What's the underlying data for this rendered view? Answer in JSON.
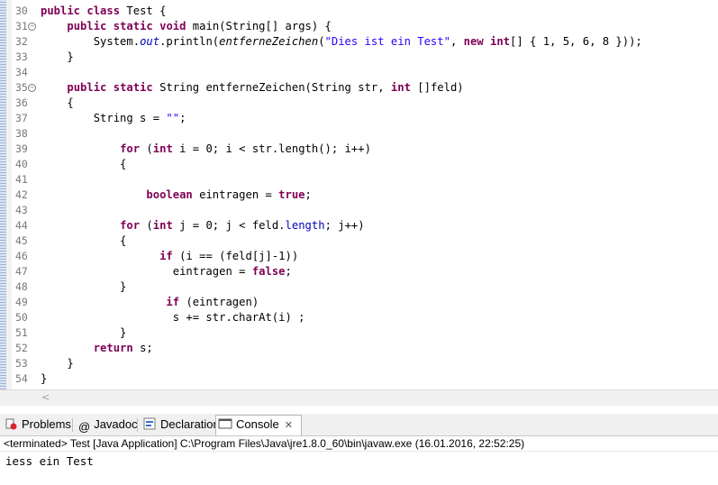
{
  "editor": {
    "lines": [
      {
        "n": "30",
        "fold": false,
        "tokens": [
          [
            "kw",
            "public"
          ],
          [
            "p",
            " "
          ],
          [
            "kw",
            "class"
          ],
          [
            "p",
            " Test {"
          ]
        ]
      },
      {
        "n": "31",
        "fold": true,
        "tokens": [
          [
            "p",
            "    "
          ],
          [
            "kw",
            "public"
          ],
          [
            "p",
            " "
          ],
          [
            "kw",
            "static"
          ],
          [
            "p",
            " "
          ],
          [
            "kw",
            "void"
          ],
          [
            "p",
            " main(String[] args) {"
          ]
        ]
      },
      {
        "n": "32",
        "fold": false,
        "tokens": [
          [
            "p",
            "        System."
          ],
          [
            "fldit",
            "out"
          ],
          [
            "p",
            ".println("
          ],
          [
            "it",
            "entferneZeichen"
          ],
          [
            "p",
            "("
          ],
          [
            "str",
            "\"Dies ist ein Test\""
          ],
          [
            "p",
            ", "
          ],
          [
            "kw",
            "new"
          ],
          [
            "p",
            " "
          ],
          [
            "kw",
            "int"
          ],
          [
            "p",
            "[] { 1, 5, 6, 8 }));"
          ]
        ]
      },
      {
        "n": "33",
        "fold": false,
        "tokens": [
          [
            "p",
            "    }"
          ]
        ]
      },
      {
        "n": "34",
        "fold": false,
        "tokens": []
      },
      {
        "n": "35",
        "fold": true,
        "tokens": [
          [
            "p",
            "    "
          ],
          [
            "kw",
            "public"
          ],
          [
            "p",
            " "
          ],
          [
            "kw",
            "static"
          ],
          [
            "p",
            " String entferneZeichen(String str, "
          ],
          [
            "kw",
            "int"
          ],
          [
            "p",
            " []feld)"
          ]
        ]
      },
      {
        "n": "36",
        "fold": false,
        "tokens": [
          [
            "p",
            "    {"
          ]
        ]
      },
      {
        "n": "37",
        "fold": false,
        "tokens": [
          [
            "p",
            "        String s = "
          ],
          [
            "str",
            "\"\""
          ],
          [
            "p",
            ";"
          ]
        ]
      },
      {
        "n": "38",
        "fold": false,
        "tokens": []
      },
      {
        "n": "39",
        "fold": false,
        "tokens": [
          [
            "p",
            "            "
          ],
          [
            "kw",
            "for"
          ],
          [
            "p",
            " ("
          ],
          [
            "kw",
            "int"
          ],
          [
            "p",
            " i = 0; i < str.length(); i++)"
          ]
        ]
      },
      {
        "n": "40",
        "fold": false,
        "tokens": [
          [
            "p",
            "            {"
          ]
        ]
      },
      {
        "n": "41",
        "fold": false,
        "tokens": []
      },
      {
        "n": "42",
        "fold": false,
        "tokens": [
          [
            "p",
            "                "
          ],
          [
            "kw",
            "boolean"
          ],
          [
            "p",
            " eintragen = "
          ],
          [
            "kw",
            "true"
          ],
          [
            "p",
            ";"
          ]
        ]
      },
      {
        "n": "43",
        "fold": false,
        "tokens": []
      },
      {
        "n": "44",
        "fold": false,
        "tokens": [
          [
            "p",
            "            "
          ],
          [
            "kw",
            "for"
          ],
          [
            "p",
            " ("
          ],
          [
            "kw",
            "int"
          ],
          [
            "p",
            " j = 0; j < feld."
          ],
          [
            "fld",
            "length"
          ],
          [
            "p",
            "; j++)"
          ]
        ]
      },
      {
        "n": "45",
        "fold": false,
        "tokens": [
          [
            "p",
            "            {"
          ]
        ]
      },
      {
        "n": "46",
        "fold": false,
        "tokens": [
          [
            "p",
            "                  "
          ],
          [
            "kw",
            "if"
          ],
          [
            "p",
            " (i == (feld[j]-1))"
          ]
        ]
      },
      {
        "n": "47",
        "fold": false,
        "tokens": [
          [
            "p",
            "                    eintragen = "
          ],
          [
            "kw",
            "false"
          ],
          [
            "p",
            ";"
          ]
        ]
      },
      {
        "n": "48",
        "fold": false,
        "tokens": [
          [
            "p",
            "            }"
          ]
        ]
      },
      {
        "n": "49",
        "fold": false,
        "tokens": [
          [
            "p",
            "                   "
          ],
          [
            "kw",
            "if"
          ],
          [
            "p",
            " (eintragen)"
          ]
        ]
      },
      {
        "n": "50",
        "fold": false,
        "tokens": [
          [
            "p",
            "                    s += str.charAt(i) ;"
          ]
        ]
      },
      {
        "n": "51",
        "fold": false,
        "tokens": [
          [
            "p",
            "            }"
          ]
        ]
      },
      {
        "n": "52",
        "fold": false,
        "tokens": [
          [
            "p",
            "        "
          ],
          [
            "kw",
            "return"
          ],
          [
            "p",
            " s;"
          ]
        ]
      },
      {
        "n": "53",
        "fold": false,
        "tokens": [
          [
            "p",
            "    }"
          ]
        ]
      },
      {
        "n": "54",
        "fold": false,
        "tokens": [
          [
            "p",
            "}"
          ]
        ]
      }
    ]
  },
  "tabs": {
    "problems": "Problems",
    "javadoc": "Javadoc",
    "declaration": "Declaration",
    "console": "Console"
  },
  "status_text": "<terminated> Test [Java Application] C:\\Program Files\\Java\\jre1.8.0_60\\bin\\javaw.exe (16.01.2016, 22:52:25)",
  "console_output": "iess ein Test",
  "colors": {
    "keyword": "#7f0055",
    "string": "#2a00ff",
    "field": "#0000c0"
  }
}
